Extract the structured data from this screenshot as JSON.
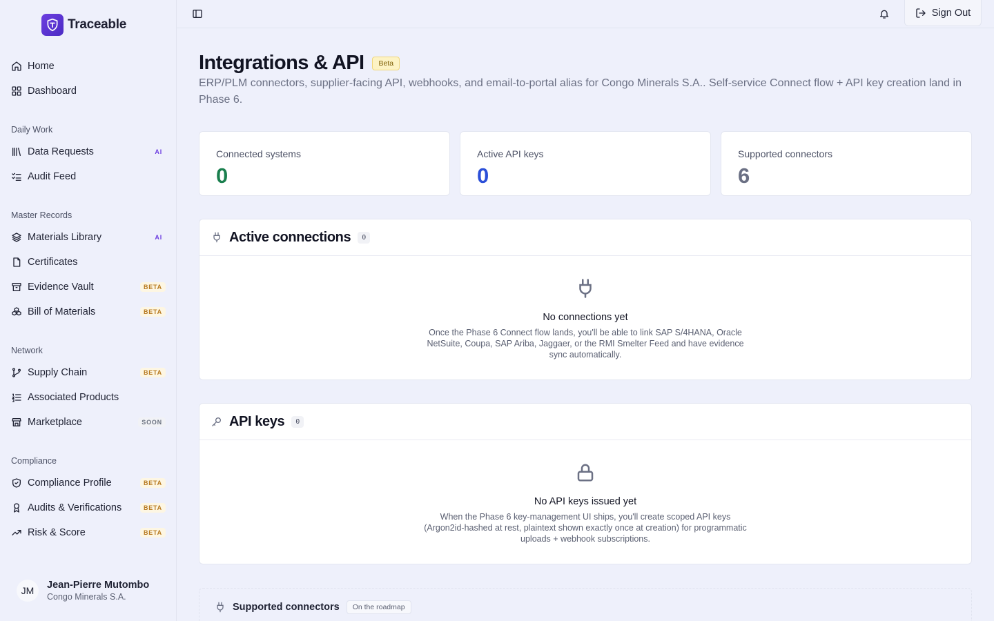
{
  "brand": {
    "name": "Traceable"
  },
  "nav": {
    "top": [
      {
        "label": "Home",
        "icon": "home-icon",
        "badge": ""
      },
      {
        "label": "Dashboard",
        "icon": "grid-icon",
        "badge": ""
      }
    ],
    "sections": [
      {
        "label": "Daily Work",
        "items": [
          {
            "label": "Data Requests",
            "icon": "library-icon",
            "badge": "AI"
          },
          {
            "label": "Audit Feed",
            "icon": "list-checks-icon",
            "badge": ""
          }
        ]
      },
      {
        "label": "Master Records",
        "items": [
          {
            "label": "Materials Library",
            "icon": "layers-icon",
            "badge": "AI"
          },
          {
            "label": "Certificates",
            "icon": "file-icon",
            "badge": ""
          },
          {
            "label": "Evidence Vault",
            "icon": "archive-icon",
            "badge": "BETA"
          },
          {
            "label": "Bill of Materials",
            "icon": "boxes-icon",
            "badge": "BETA"
          }
        ]
      },
      {
        "label": "Network",
        "items": [
          {
            "label": "Supply Chain",
            "icon": "git-branch-icon",
            "badge": "BETA"
          },
          {
            "label": "Associated Products",
            "icon": "list-ordered-icon",
            "badge": ""
          },
          {
            "label": "Marketplace",
            "icon": "store-icon",
            "badge": "SOON"
          }
        ]
      },
      {
        "label": "Compliance",
        "items": [
          {
            "label": "Compliance Profile",
            "icon": "shield-check-icon",
            "badge": "BETA"
          },
          {
            "label": "Audits & Verifications",
            "icon": "award-icon",
            "badge": "BETA"
          },
          {
            "label": "Risk & Score",
            "icon": "trending-up-icon",
            "badge": "BETA"
          }
        ]
      }
    ]
  },
  "user": {
    "initials": "JM",
    "name": "Jean-Pierre Mutombo",
    "org": "Congo Minerals S.A."
  },
  "topbar": {
    "signout_label": "Sign Out"
  },
  "page": {
    "title": "Integrations & API",
    "badge": "Beta",
    "description": "ERP/PLM connectors, supplier-facing API, webhooks, and email-to-portal alias for Congo Minerals S.A.. Self-service Connect flow + API key creation land in Phase 6."
  },
  "stats": [
    {
      "label": "Connected systems",
      "value": "0",
      "color": "#1a7f4e"
    },
    {
      "label": "Active API keys",
      "value": "0",
      "color": "#2b4fd8"
    },
    {
      "label": "Supported connectors",
      "value": "6",
      "color": "#6b7084"
    }
  ],
  "connections": {
    "title": "Active connections",
    "count": "0",
    "empty_title": "No connections yet",
    "empty_text": "Once the Phase 6 Connect flow lands, you'll be able to link SAP S/4HANA, Oracle NetSuite, Coupa, SAP Ariba, Jaggaer, or the RMI Smelter Feed and have evidence sync automatically."
  },
  "api_keys": {
    "title": "API keys",
    "count": "0",
    "empty_title": "No API keys issued yet",
    "empty_text": "When the Phase 6 key-management UI ships, you'll create scoped API keys (Argon2id-hashed at rest, plaintext shown exactly once at creation) for programmatic uploads + webhook subscriptions."
  },
  "supported": {
    "title": "Supported connectors",
    "badge": "On the roadmap"
  }
}
